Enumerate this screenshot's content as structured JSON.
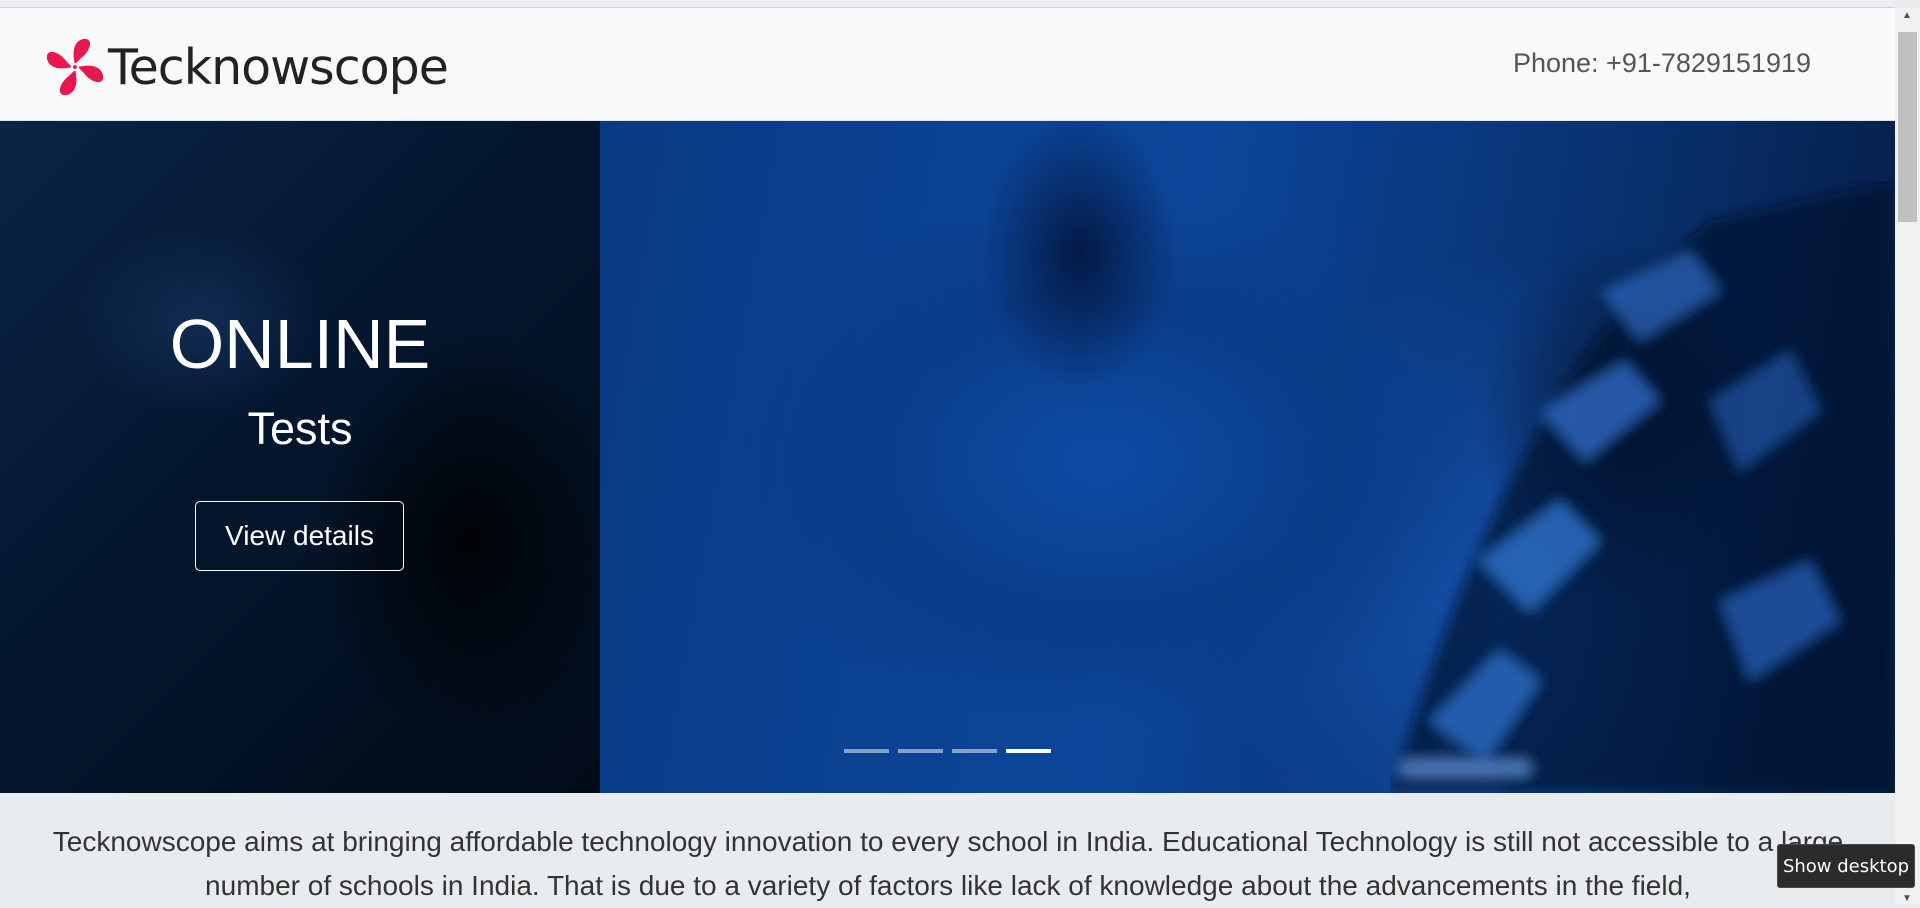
{
  "header": {
    "brand_name": "Tecknowscope",
    "logo_icon": "pinwheel-logo-icon",
    "phone": "Phone: +91-7829151919",
    "brand_color": "#e8174f"
  },
  "carousel": {
    "slide_title": "ONLINE",
    "slide_subtitle": "Tests",
    "cta_label": "View details",
    "indicator_count": 4,
    "active_indicator": 4,
    "theme_color": "#0a3f8c"
  },
  "intro": {
    "text": "Tecknowscope aims at bringing affordable technology innovation to every school in India. Educational Technology is still not accessible to a large number of schools in India. That is due to a variety of factors like lack of knowledge about the advancements in the field,"
  },
  "tooltip": {
    "label": "Show desktop"
  }
}
